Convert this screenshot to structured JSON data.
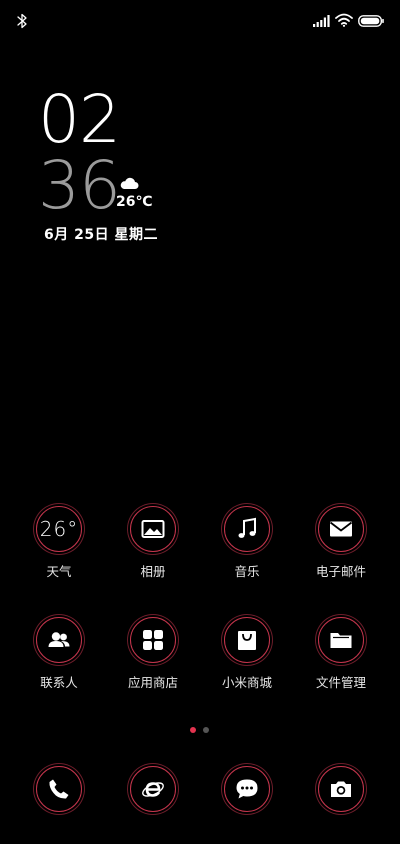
{
  "status_bar": {
    "left_icon": "bluetooth-icon",
    "right_icons": [
      "signal-icon",
      "wifi-icon",
      "battery-icon"
    ]
  },
  "clock": {
    "hour": "02",
    "minute": "36",
    "weather_temp": "26℃",
    "weather_icon": "cloud-icon",
    "date": "6月 25日  星期二"
  },
  "apps": [
    {
      "label": "天气",
      "icon_text": "26°",
      "icon": "weather-icon"
    },
    {
      "label": "相册",
      "icon": "gallery-icon"
    },
    {
      "label": "音乐",
      "icon": "music-icon"
    },
    {
      "label": "电子邮件",
      "icon": "mail-icon"
    },
    {
      "label": "联系人",
      "icon": "contacts-icon"
    },
    {
      "label": "应用商店",
      "icon": "app-store-icon"
    },
    {
      "label": "小米商城",
      "icon": "shopping-bag-icon"
    },
    {
      "label": "文件管理",
      "icon": "folder-icon"
    }
  ],
  "dock": [
    {
      "icon": "phone-icon"
    },
    {
      "icon": "browser-icon"
    },
    {
      "icon": "messages-icon"
    },
    {
      "icon": "camera-icon"
    }
  ],
  "page_indicator": {
    "current": 1,
    "total": 2
  },
  "colors": {
    "accent": "#c4354c",
    "background": "#000000",
    "dot_active": "#e2334f"
  }
}
